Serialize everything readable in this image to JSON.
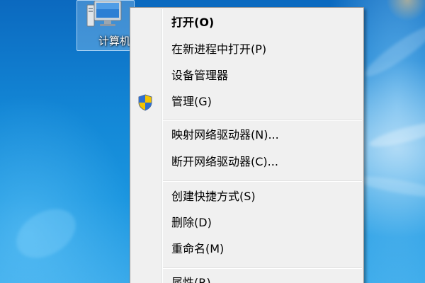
{
  "desktop": {
    "icon": {
      "label": "计算机",
      "icon_name": "computer-icon"
    }
  },
  "context_menu": {
    "items": [
      {
        "label": "打开(O)",
        "bold": true
      },
      {
        "label": "在新进程中打开(P)"
      },
      {
        "label": "设备管理器"
      },
      {
        "label": "管理(G)",
        "icon": "uac-shield-icon"
      },
      {
        "label": "映射网络驱动器(N)..."
      },
      {
        "label": "断开网络驱动器(C)..."
      },
      {
        "label": "创建快捷方式(S)"
      },
      {
        "label": "删除(D)"
      },
      {
        "label": "重命名(M)"
      },
      {
        "label": "属性(R)"
      }
    ]
  },
  "colors": {
    "menu_background": "#f0f0f0",
    "menu_border": "#979797",
    "desktop_blue": "#1387d6",
    "shield_blue": "#2f6fd0",
    "shield_yellow": "#f4c400"
  }
}
